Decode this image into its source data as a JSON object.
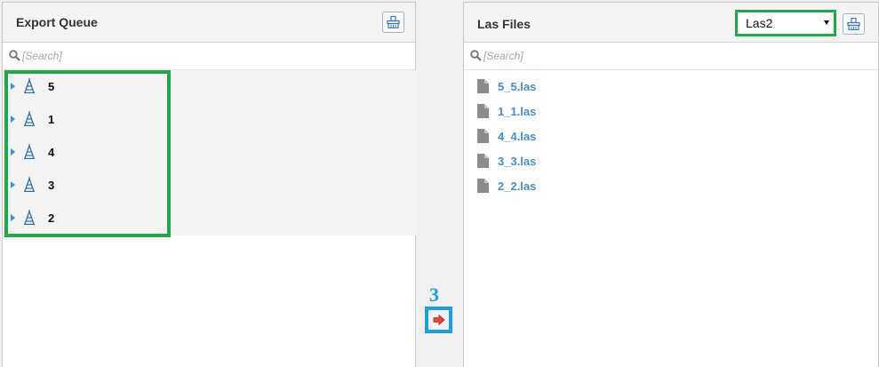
{
  "export_queue": {
    "title": "Export Queue",
    "search_placeholder": "[Search]",
    "items": [
      {
        "label": "5"
      },
      {
        "label": "1"
      },
      {
        "label": "4"
      },
      {
        "label": "3"
      },
      {
        "label": "2"
      }
    ]
  },
  "las_files": {
    "title": "Las Files",
    "selected_option": "Las2",
    "search_placeholder": "[Search]",
    "files": [
      {
        "name": "5_5.las"
      },
      {
        "name": "1_1.las"
      },
      {
        "name": "4_4.las"
      },
      {
        "name": "3_3.las"
      },
      {
        "name": "2_2.las"
      }
    ]
  },
  "annotation": {
    "step_number": "3"
  },
  "colors": {
    "highlight_green": "#22a84a",
    "highlight_blue": "#1a9fe0",
    "link_blue": "#4a8ec9",
    "arrow_red": "#e0483f"
  }
}
